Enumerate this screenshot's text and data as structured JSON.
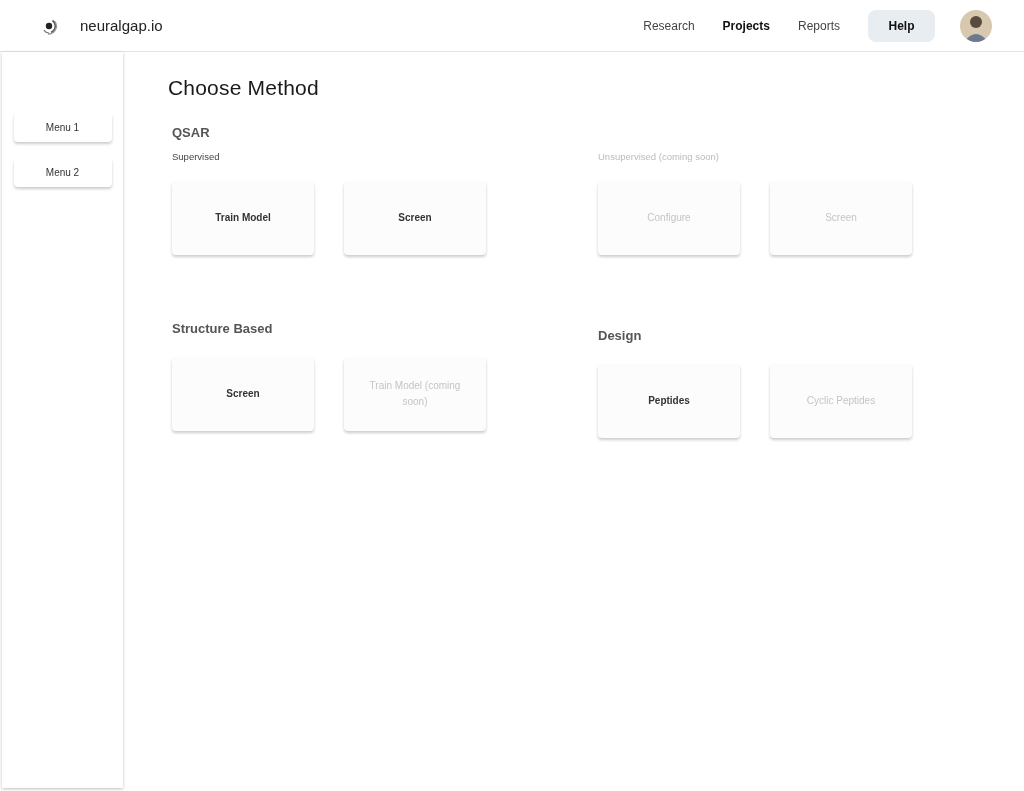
{
  "brand": {
    "name": "neuralgap.io"
  },
  "nav": [
    {
      "label": "Research",
      "kind": "link",
      "selected": false
    },
    {
      "label": "Projects",
      "kind": "link",
      "selected": true
    },
    {
      "label": "Reports",
      "kind": "link",
      "selected": false
    },
    {
      "label": "Help",
      "kind": "button",
      "selected": false
    }
  ],
  "sidebar": {
    "items": [
      {
        "label": "Menu 1"
      },
      {
        "label": "Menu 2"
      }
    ]
  },
  "page_title": "Choose Method",
  "qsar": {
    "title": "QSAR",
    "groups": [
      {
        "label": "Supervised",
        "disabled": false,
        "cards": [
          {
            "label": "Train Model",
            "disabled": false
          },
          {
            "label": "Screen",
            "disabled": false
          }
        ]
      },
      {
        "label": "Unsupervised (coming soon)",
        "disabled": true,
        "cards": [
          {
            "label": "Configure",
            "disabled": true
          },
          {
            "label": "Screen",
            "disabled": true
          }
        ]
      }
    ]
  },
  "structure_based": {
    "title": "Structure Based",
    "cards": [
      {
        "label": "Screen",
        "disabled": false
      },
      {
        "label": "Train Model (coming soon)",
        "disabled": true
      }
    ]
  },
  "design": {
    "title": "Design",
    "cards": [
      {
        "label": "Peptides",
        "disabled": false
      },
      {
        "label": "Cyclic Peptides",
        "disabled": true
      }
    ]
  }
}
